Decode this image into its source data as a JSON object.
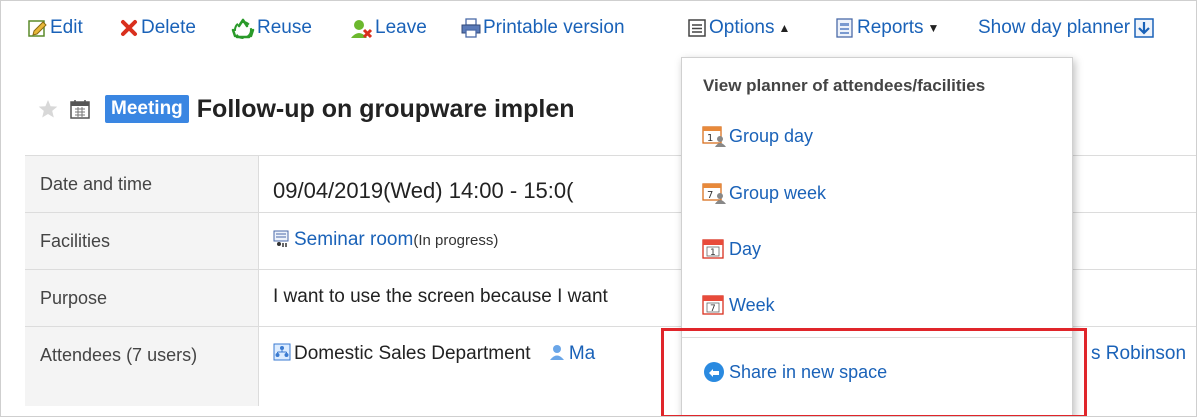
{
  "toolbar": {
    "edit": "Edit",
    "delete": "Delete",
    "reuse": "Reuse",
    "leave": "Leave",
    "printable": "Printable version",
    "options": "Options",
    "reports": "Reports",
    "show_day_planner": "Show day planner"
  },
  "event": {
    "category": "Meeting",
    "title": "Follow-up on groupware implen"
  },
  "details": {
    "date_label": "Date and time",
    "date_value": "09/04/2019(Wed)   14:00  -  15:0(",
    "facilities_label": "Facilities",
    "facility_name": "Seminar room",
    "facility_status": "(In progress)",
    "purpose_label": "Purpose",
    "purpose_value": "I want to use the screen because I want",
    "attendees_label": "Attendees (7 users)",
    "attendee_org": "Domestic Sales Department",
    "attendee_1": "Ma",
    "attendee_right": "s Robinson"
  },
  "options_menu": {
    "heading": "View planner of attendees/facilities",
    "items": [
      {
        "label": "Group day",
        "icon": "group-day-icon"
      },
      {
        "label": "Group week",
        "icon": "group-week-icon"
      },
      {
        "label": "Day",
        "icon": "day-calendar-icon"
      },
      {
        "label": "Week",
        "icon": "week-calendar-icon"
      },
      {
        "label": "Share in new space",
        "icon": "share-space-icon"
      }
    ],
    "group_day_digit": "1",
    "group_week_digit": "7",
    "day_digit": "1",
    "week_digit": "7"
  },
  "colors": {
    "link": "#1a62b8",
    "badge": "#3a86e2",
    "highlight": "#e0252a"
  }
}
